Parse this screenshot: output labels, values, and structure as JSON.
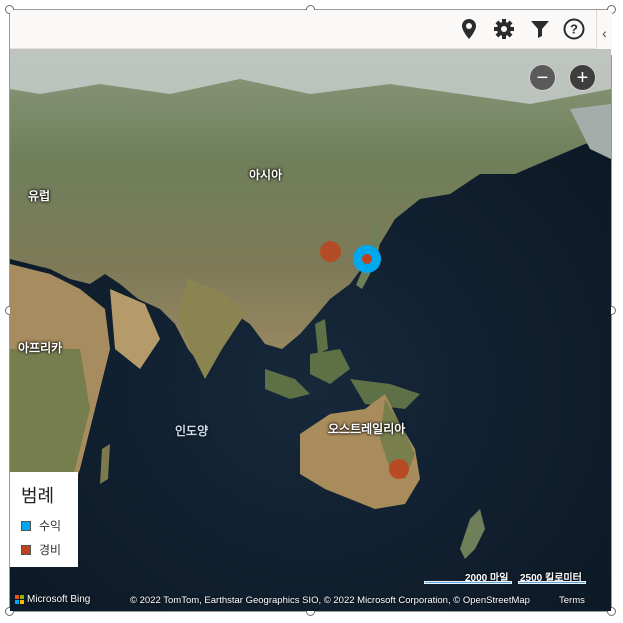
{
  "toolbar": {
    "buttons": [
      {
        "name": "location-pin-icon"
      },
      {
        "name": "gear-icon"
      },
      {
        "name": "filter-icon"
      },
      {
        "name": "help-icon"
      }
    ],
    "collapse_glyph": "‹"
  },
  "map": {
    "zoom_out_glyph": "−",
    "zoom_in_glyph": "+",
    "labels": {
      "europe": "유럽",
      "asia": "아시아",
      "africa": "아프리카",
      "indian_ocean": "인도양",
      "australia": "오스트레일리아"
    },
    "markers": [
      {
        "series": "경비",
        "location": "China (Shanghai area)"
      },
      {
        "series": "수익",
        "location": "Japan"
      },
      {
        "series": "경비",
        "location": "Japan"
      },
      {
        "series": "경비",
        "location": "Australia (Sydney)"
      }
    ]
  },
  "legend": {
    "title": "범례",
    "items": [
      {
        "label": "수익",
        "color": "#00a8f0"
      },
      {
        "label": "경비",
        "color": "#c0411c"
      }
    ]
  },
  "footer": {
    "brand": "Microsoft Bing",
    "copyright": "© 2022 TomTom, Earthstar Geographics SIO, © 2022 Microsoft Corporation, © OpenStreetMap",
    "terms": "Terms",
    "scale_miles": "2000 마일",
    "scale_km": "2500 킬로미터"
  },
  "colors": {
    "revenue": "#00a8f0",
    "expense": "#c0411c",
    "toolbar_bg": "#fbf9f8"
  }
}
